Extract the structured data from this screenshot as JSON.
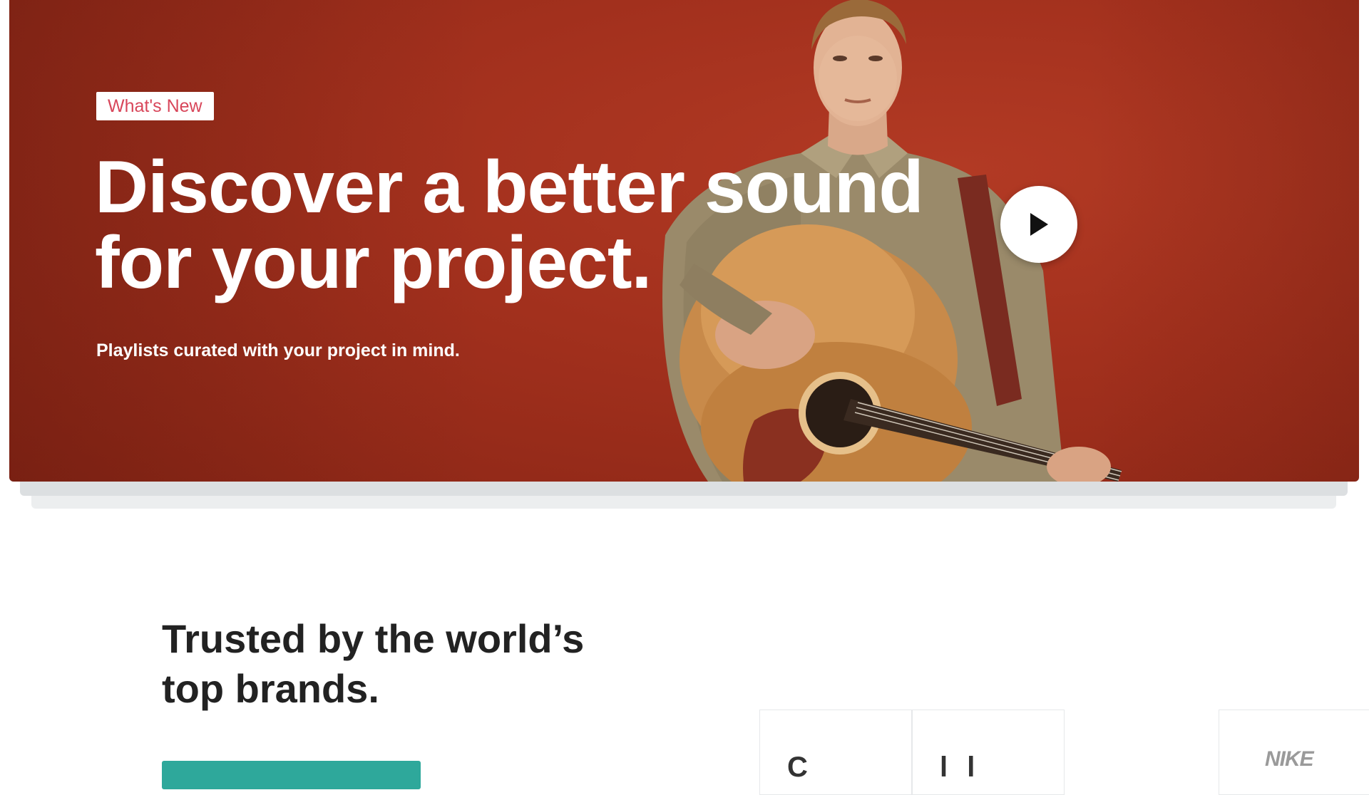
{
  "hero": {
    "badge": "What's New",
    "title_line1": "Discover a better sound",
    "title_line2": "for your project.",
    "subtitle": "Playlists curated with your project in mind.",
    "background_color": "#a2301d",
    "badge_color": "#d8465a"
  },
  "trusted": {
    "title_line1": "Trusted by the world’s",
    "title_line2": "top brands.",
    "cta_color": "#2ea89b",
    "brands": [
      {
        "name": "brand-1",
        "glyph": "C"
      },
      {
        "name": "brand-2",
        "glyph": "l l"
      },
      {
        "name": "nike",
        "glyph": "NIKE"
      }
    ]
  },
  "icons": {
    "play": "play-icon"
  }
}
